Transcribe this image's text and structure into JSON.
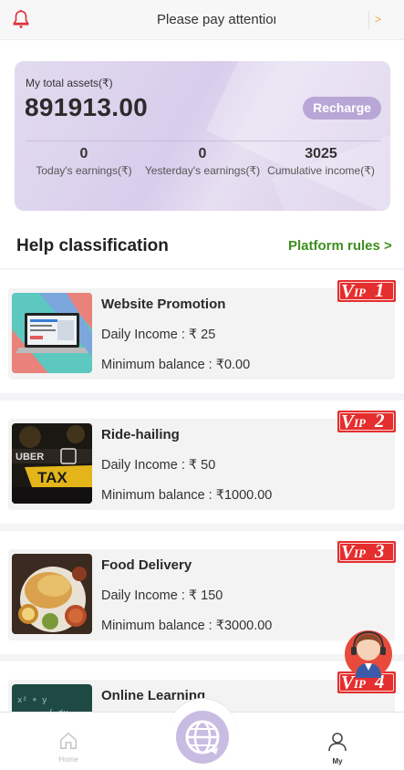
{
  "notice": {
    "text": "Please pay attention",
    "more": ">"
  },
  "assets": {
    "label": "My total assets(₹)",
    "amount": "891913.00",
    "recharge_label": "Recharge",
    "stats": [
      {
        "value": "0",
        "label": "Today's earnings(₹)"
      },
      {
        "value": "0",
        "label": "Yesterday's earnings(₹)"
      },
      {
        "value": "3025",
        "label": "Cumulative income(₹)"
      }
    ]
  },
  "help": {
    "title": "Help classification",
    "rules_link": "Platform rules >"
  },
  "tasks": [
    {
      "name": "Website Promotion",
      "daily": "Daily Income : ₹ 25",
      "min_balance": "Minimum balance : ₹0.00",
      "vip": "1"
    },
    {
      "name": "Ride-hailing",
      "daily": "Daily Income : ₹ 50",
      "min_balance": "Minimum balance : ₹1000.00",
      "vip": "2"
    },
    {
      "name": "Food Delivery",
      "daily": "Daily Income : ₹ 150",
      "min_balance": "Minimum balance : ₹3000.00",
      "vip": "3"
    },
    {
      "name": "Online Learning",
      "daily": "",
      "min_balance": "",
      "vip": "4"
    }
  ],
  "vip_prefix": {
    "v": "V",
    "ip": "IP"
  },
  "nav": {
    "home": "Home",
    "my": "My"
  },
  "colors": {
    "accent_purple": "#b8a6d6",
    "link_green": "#3f8e1f",
    "vip_red": "#e52e2e",
    "bell_red": "#d9363e"
  },
  "icons": {
    "notice": "bell-icon",
    "home": "home-icon",
    "center": "globe-icon",
    "my": "user-icon",
    "support": "customer-service-icon"
  }
}
